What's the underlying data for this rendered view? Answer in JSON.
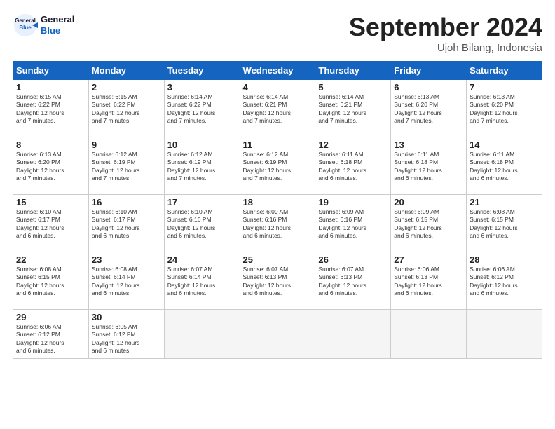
{
  "logo": {
    "line1": "General",
    "line2": "Blue"
  },
  "header": {
    "month": "September 2024",
    "location": "Ujoh Bilang, Indonesia"
  },
  "weekdays": [
    "Sunday",
    "Monday",
    "Tuesday",
    "Wednesday",
    "Thursday",
    "Friday",
    "Saturday"
  ],
  "weeks": [
    [
      {
        "day": "1",
        "lines": [
          "Sunrise: 6:15 AM",
          "Sunset: 6:22 PM",
          "Daylight: 12 hours",
          "and 7 minutes."
        ]
      },
      {
        "day": "2",
        "lines": [
          "Sunrise: 6:15 AM",
          "Sunset: 6:22 PM",
          "Daylight: 12 hours",
          "and 7 minutes."
        ]
      },
      {
        "day": "3",
        "lines": [
          "Sunrise: 6:14 AM",
          "Sunset: 6:22 PM",
          "Daylight: 12 hours",
          "and 7 minutes."
        ]
      },
      {
        "day": "4",
        "lines": [
          "Sunrise: 6:14 AM",
          "Sunset: 6:21 PM",
          "Daylight: 12 hours",
          "and 7 minutes."
        ]
      },
      {
        "day": "5",
        "lines": [
          "Sunrise: 6:14 AM",
          "Sunset: 6:21 PM",
          "Daylight: 12 hours",
          "and 7 minutes."
        ]
      },
      {
        "day": "6",
        "lines": [
          "Sunrise: 6:13 AM",
          "Sunset: 6:20 PM",
          "Daylight: 12 hours",
          "and 7 minutes."
        ]
      },
      {
        "day": "7",
        "lines": [
          "Sunrise: 6:13 AM",
          "Sunset: 6:20 PM",
          "Daylight: 12 hours",
          "and 7 minutes."
        ]
      }
    ],
    [
      {
        "day": "8",
        "lines": [
          "Sunrise: 6:13 AM",
          "Sunset: 6:20 PM",
          "Daylight: 12 hours",
          "and 7 minutes."
        ]
      },
      {
        "day": "9",
        "lines": [
          "Sunrise: 6:12 AM",
          "Sunset: 6:19 PM",
          "Daylight: 12 hours",
          "and 7 minutes."
        ]
      },
      {
        "day": "10",
        "lines": [
          "Sunrise: 6:12 AM",
          "Sunset: 6:19 PM",
          "Daylight: 12 hours",
          "and 7 minutes."
        ]
      },
      {
        "day": "11",
        "lines": [
          "Sunrise: 6:12 AM",
          "Sunset: 6:19 PM",
          "Daylight: 12 hours",
          "and 7 minutes."
        ]
      },
      {
        "day": "12",
        "lines": [
          "Sunrise: 6:11 AM",
          "Sunset: 6:18 PM",
          "Daylight: 12 hours",
          "and 6 minutes."
        ]
      },
      {
        "day": "13",
        "lines": [
          "Sunrise: 6:11 AM",
          "Sunset: 6:18 PM",
          "Daylight: 12 hours",
          "and 6 minutes."
        ]
      },
      {
        "day": "14",
        "lines": [
          "Sunrise: 6:11 AM",
          "Sunset: 6:18 PM",
          "Daylight: 12 hours",
          "and 6 minutes."
        ]
      }
    ],
    [
      {
        "day": "15",
        "lines": [
          "Sunrise: 6:10 AM",
          "Sunset: 6:17 PM",
          "Daylight: 12 hours",
          "and 6 minutes."
        ]
      },
      {
        "day": "16",
        "lines": [
          "Sunrise: 6:10 AM",
          "Sunset: 6:17 PM",
          "Daylight: 12 hours",
          "and 6 minutes."
        ]
      },
      {
        "day": "17",
        "lines": [
          "Sunrise: 6:10 AM",
          "Sunset: 6:16 PM",
          "Daylight: 12 hours",
          "and 6 minutes."
        ]
      },
      {
        "day": "18",
        "lines": [
          "Sunrise: 6:09 AM",
          "Sunset: 6:16 PM",
          "Daylight: 12 hours",
          "and 6 minutes."
        ]
      },
      {
        "day": "19",
        "lines": [
          "Sunrise: 6:09 AM",
          "Sunset: 6:16 PM",
          "Daylight: 12 hours",
          "and 6 minutes."
        ]
      },
      {
        "day": "20",
        "lines": [
          "Sunrise: 6:09 AM",
          "Sunset: 6:15 PM",
          "Daylight: 12 hours",
          "and 6 minutes."
        ]
      },
      {
        "day": "21",
        "lines": [
          "Sunrise: 6:08 AM",
          "Sunset: 6:15 PM",
          "Daylight: 12 hours",
          "and 6 minutes."
        ]
      }
    ],
    [
      {
        "day": "22",
        "lines": [
          "Sunrise: 6:08 AM",
          "Sunset: 6:15 PM",
          "Daylight: 12 hours",
          "and 6 minutes."
        ]
      },
      {
        "day": "23",
        "lines": [
          "Sunrise: 6:08 AM",
          "Sunset: 6:14 PM",
          "Daylight: 12 hours",
          "and 6 minutes."
        ]
      },
      {
        "day": "24",
        "lines": [
          "Sunrise: 6:07 AM",
          "Sunset: 6:14 PM",
          "Daylight: 12 hours",
          "and 6 minutes."
        ]
      },
      {
        "day": "25",
        "lines": [
          "Sunrise: 6:07 AM",
          "Sunset: 6:13 PM",
          "Daylight: 12 hours",
          "and 6 minutes."
        ]
      },
      {
        "day": "26",
        "lines": [
          "Sunrise: 6:07 AM",
          "Sunset: 6:13 PM",
          "Daylight: 12 hours",
          "and 6 minutes."
        ]
      },
      {
        "day": "27",
        "lines": [
          "Sunrise: 6:06 AM",
          "Sunset: 6:13 PM",
          "Daylight: 12 hours",
          "and 6 minutes."
        ]
      },
      {
        "day": "28",
        "lines": [
          "Sunrise: 6:06 AM",
          "Sunset: 6:12 PM",
          "Daylight: 12 hours",
          "and 6 minutes."
        ]
      }
    ],
    [
      {
        "day": "29",
        "lines": [
          "Sunrise: 6:06 AM",
          "Sunset: 6:12 PM",
          "Daylight: 12 hours",
          "and 6 minutes."
        ]
      },
      {
        "day": "30",
        "lines": [
          "Sunrise: 6:05 AM",
          "Sunset: 6:12 PM",
          "Daylight: 12 hours",
          "and 6 minutes."
        ]
      },
      {
        "day": "",
        "lines": []
      },
      {
        "day": "",
        "lines": []
      },
      {
        "day": "",
        "lines": []
      },
      {
        "day": "",
        "lines": []
      },
      {
        "day": "",
        "lines": []
      }
    ]
  ]
}
